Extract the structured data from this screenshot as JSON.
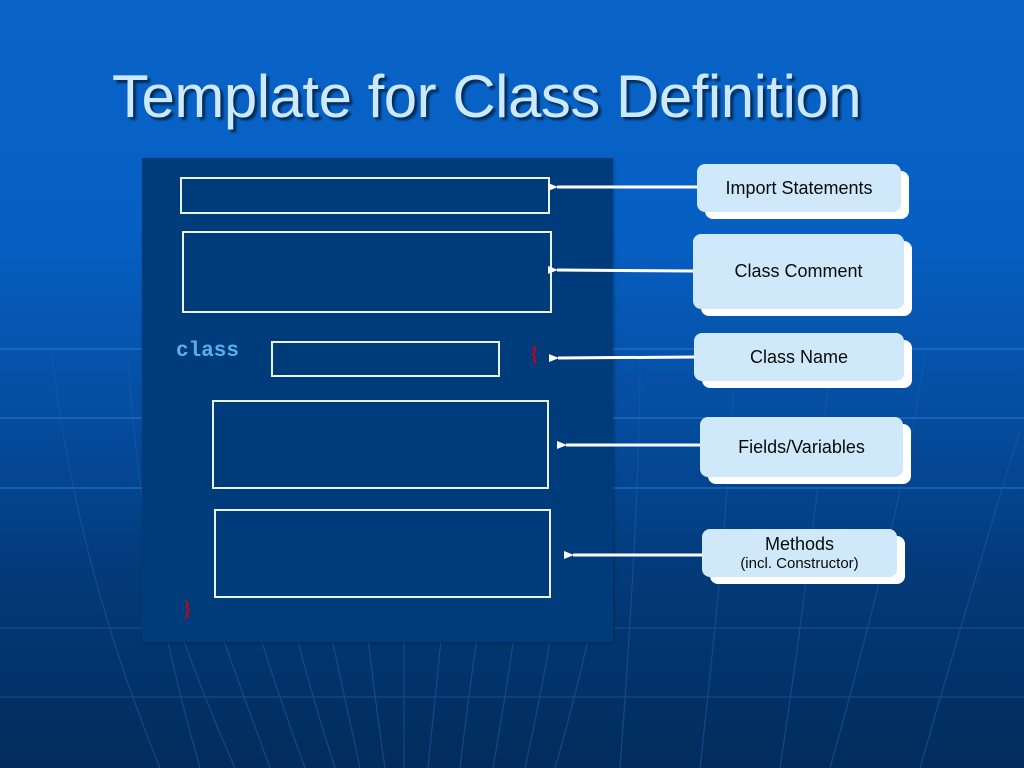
{
  "slide": {
    "title": "Template for Class Definition",
    "background_color": "#0a64c8",
    "panel_color": "#003c7c"
  },
  "template": {
    "keyword": "class",
    "open_brace": "{",
    "close_brace": "}",
    "slots": [
      {
        "name": "import-statements-slot"
      },
      {
        "name": "class-comment-slot"
      },
      {
        "name": "class-name-slot"
      },
      {
        "name": "fields-slot"
      },
      {
        "name": "methods-slot"
      }
    ]
  },
  "callouts": [
    {
      "label": "Import Statements"
    },
    {
      "label": "Class Comment"
    },
    {
      "label": "Class Name"
    },
    {
      "label": "Fields/Variables"
    },
    {
      "label": "Methods",
      "sublabel": "(incl. Constructor)"
    }
  ],
  "colors": {
    "title_text": "#cce9ff",
    "keyword": "#5ab0ee",
    "brace": "#a0102a",
    "callout_fill": "#cfe9fb",
    "arrow": "#ffffff"
  }
}
